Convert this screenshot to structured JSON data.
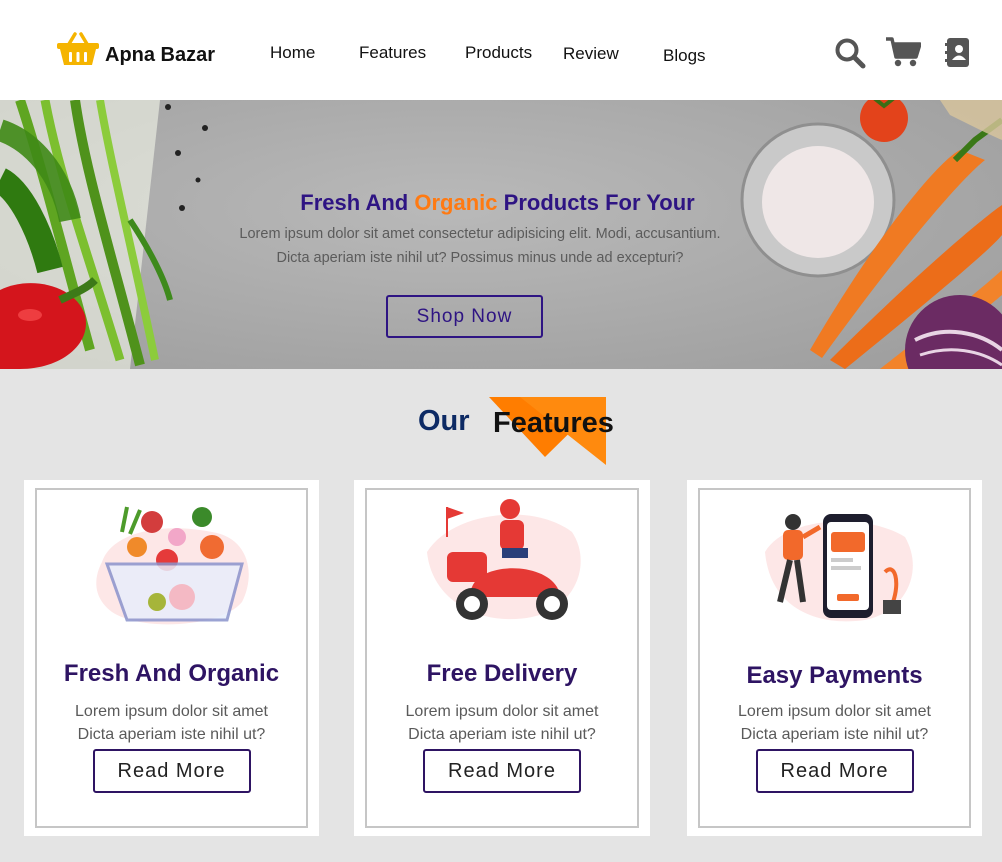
{
  "brand": {
    "name": "Apna Bazar",
    "logo_icon": "basket-icon",
    "logo_color": "#f5b400"
  },
  "nav": {
    "items": [
      {
        "label": "Home"
      },
      {
        "label": "Features"
      },
      {
        "label": "Products"
      },
      {
        "label": "Review"
      },
      {
        "label": "Blogs"
      }
    ]
  },
  "header_icons": [
    "search-icon",
    "cart-icon",
    "contact-book-icon"
  ],
  "hero": {
    "title_start": "Fresh And",
    "title_accent": "Organic",
    "title_end": "Products For Your",
    "description_line1": "Lorem ipsum dolor sit amet consectetur adipisicing elit. Modi, accusantium.",
    "description_line2": "Dicta aperiam iste nihil ut? Possimus minus unde ad excepturi?",
    "button_label": "Shop Now"
  },
  "features": {
    "heading_our": "Our",
    "heading_features": "Features",
    "cards": [
      {
        "title": "Fresh And Organic",
        "desc_line1": "Lorem ipsum dolor sit amet",
        "desc_line2": "Dicta aperiam iste nihil ut?",
        "button_label": "Read More",
        "illustration": "vegetable-basket-illustration"
      },
      {
        "title": "Free Delivery",
        "desc_line1": "Lorem ipsum dolor sit amet",
        "desc_line2": "Dicta aperiam iste nihil ut?",
        "button_label": "Read More",
        "illustration": "delivery-scooter-illustration"
      },
      {
        "title": "Easy Payments",
        "desc_line1": "Lorem ipsum dolor sit amet",
        "desc_line2": "Dicta aperiam iste nihil ut?",
        "button_label": "Read More",
        "illustration": "mobile-payment-illustration"
      }
    ]
  },
  "colors": {
    "primary": "#2e1483",
    "accent": "#ff7a12",
    "heading_dark": "#0d2a64",
    "page_bg": "#e4e4e4"
  }
}
